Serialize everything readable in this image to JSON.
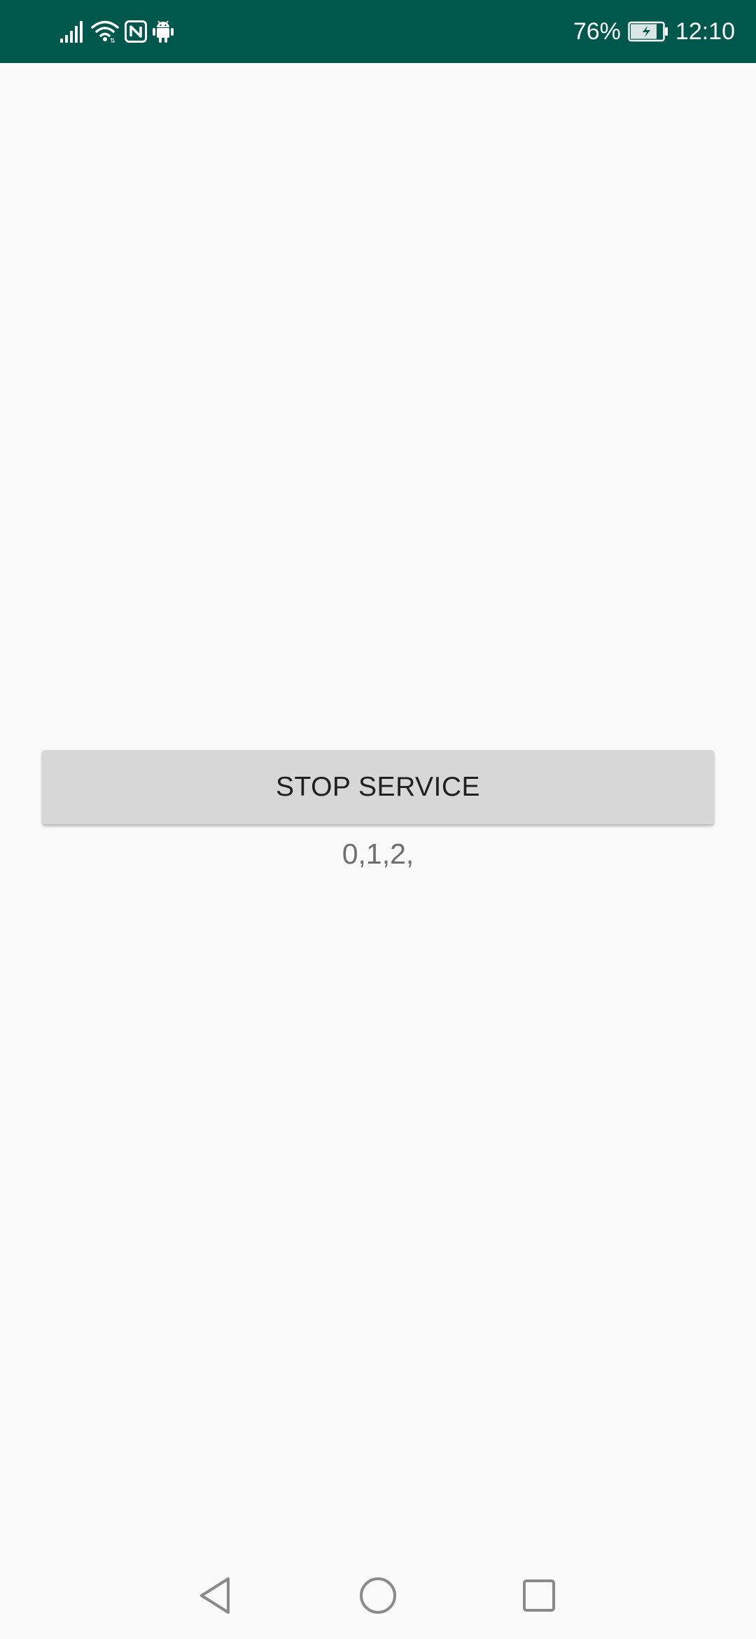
{
  "status_bar": {
    "background": "#00574b",
    "icons_left": [
      "signal-icon",
      "wifi-icon",
      "nfc-icon",
      "android-icon"
    ],
    "battery_percent_text": "76%",
    "battery_icon": "battery-charging-icon",
    "time": "12:10"
  },
  "main": {
    "stop_button_label": "STOP SERVICE",
    "counter_text": "0,1,2,"
  },
  "nav_bar": {
    "back": "back-icon",
    "home": "home-icon",
    "recents": "recents-icon"
  }
}
